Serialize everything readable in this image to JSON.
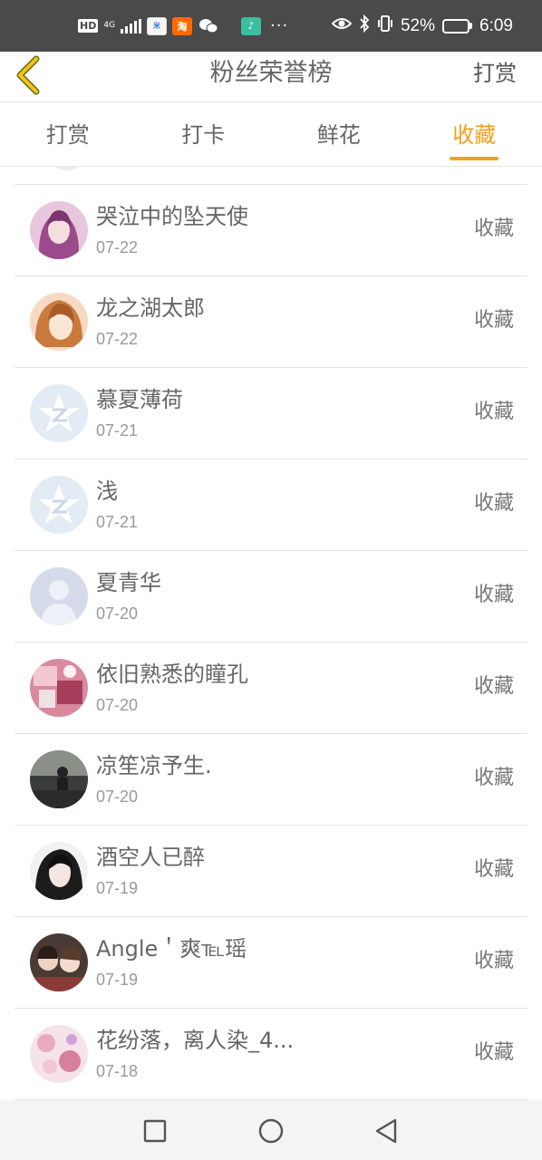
{
  "status_bar": {
    "hd": "HD",
    "network": "4G",
    "app_icons": [
      "xiaomi-store-icon",
      "taobao-icon",
      "wechat-icon",
      "game-app-icon"
    ],
    "more": "···",
    "battery": "52%",
    "battery_level": 0.52,
    "time": "6:09"
  },
  "header": {
    "title": "粉丝荣誉榜",
    "right_link": "打赏"
  },
  "tabs": [
    {
      "label": "打赏",
      "active": false
    },
    {
      "label": "打卡",
      "active": false
    },
    {
      "label": "鲜花",
      "active": false
    },
    {
      "label": "收藏",
      "active": true
    }
  ],
  "accent_color": "#f2a01e",
  "fans": [
    {
      "name": "哭泣中的坠天使",
      "date": "07-22",
      "action": "收藏",
      "avatar": "anime-girl-purple"
    },
    {
      "name": "龙之湖太郎",
      "date": "07-22",
      "action": "收藏",
      "avatar": "anime-girl-blonde"
    },
    {
      "name": "慕夏薄荷",
      "date": "07-21",
      "action": "收藏",
      "avatar": "qq-default"
    },
    {
      "name": "浅",
      "date": "07-21",
      "action": "收藏",
      "avatar": "qq-default"
    },
    {
      "name": "夏青华",
      "date": "07-20",
      "action": "收藏",
      "avatar": "default-person"
    },
    {
      "name": "依旧熟悉的瞳孔",
      "date": "07-20",
      "action": "收藏",
      "avatar": "pink-collage"
    },
    {
      "name": "凉笙凉予生.",
      "date": "07-20",
      "action": "收藏",
      "avatar": "dark-photo"
    },
    {
      "name": "酒空人已醉",
      "date": "07-19",
      "action": "收藏",
      "avatar": "girl-photo"
    },
    {
      "name": "Angle＇爽℡瑶",
      "date": "07-19",
      "action": "收藏",
      "avatar": "couple-photo"
    },
    {
      "name": "花纷落，离人染_4...",
      "date": "07-18",
      "action": "收藏",
      "avatar": "flower-collage"
    }
  ]
}
